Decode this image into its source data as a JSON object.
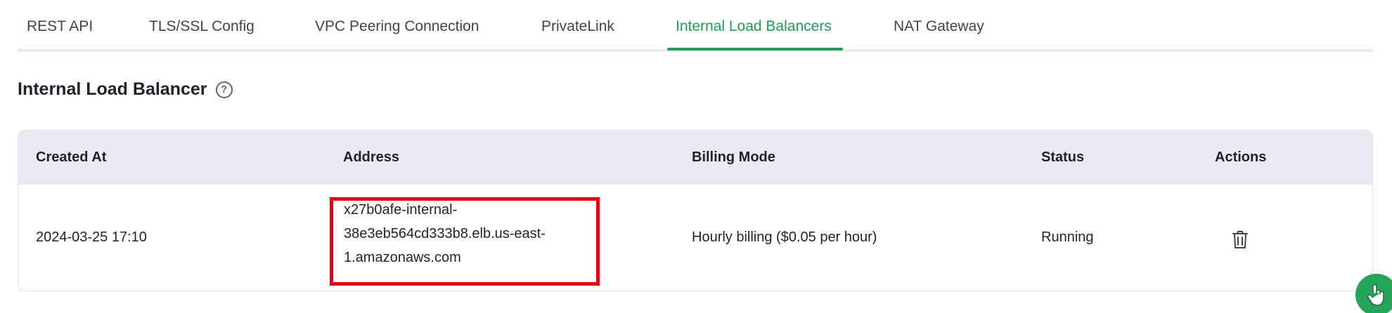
{
  "tabs": [
    {
      "label": "REST API",
      "active": false
    },
    {
      "label": "TLS/SSL Config",
      "active": false
    },
    {
      "label": "VPC Peering Connection",
      "active": false
    },
    {
      "label": "PrivateLink",
      "active": false
    },
    {
      "label": "Internal Load Balancers",
      "active": true
    },
    {
      "label": "NAT Gateway",
      "active": false
    }
  ],
  "section": {
    "title": "Internal Load Balancer",
    "help_icon": "question-circle-icon"
  },
  "table": {
    "columns": [
      "Created At",
      "Address",
      "Billing Mode",
      "Status",
      "Actions"
    ],
    "rows": [
      {
        "created_at": "2024-03-25 17:10",
        "address_lines": [
          "x27b0afe-internal-",
          "38e3eb564cd333b8.elb.us-east-",
          "1.amazonaws.com"
        ],
        "billing_mode": "Hourly billing ($0.05 per hour)",
        "status": "Running",
        "action_icon": "trash-icon"
      }
    ]
  },
  "colors": {
    "accent": "#1e9e52",
    "highlight": "#e60012",
    "header_bg": "#e8ecf2"
  },
  "fab_icon": "hand-pointer-icon"
}
